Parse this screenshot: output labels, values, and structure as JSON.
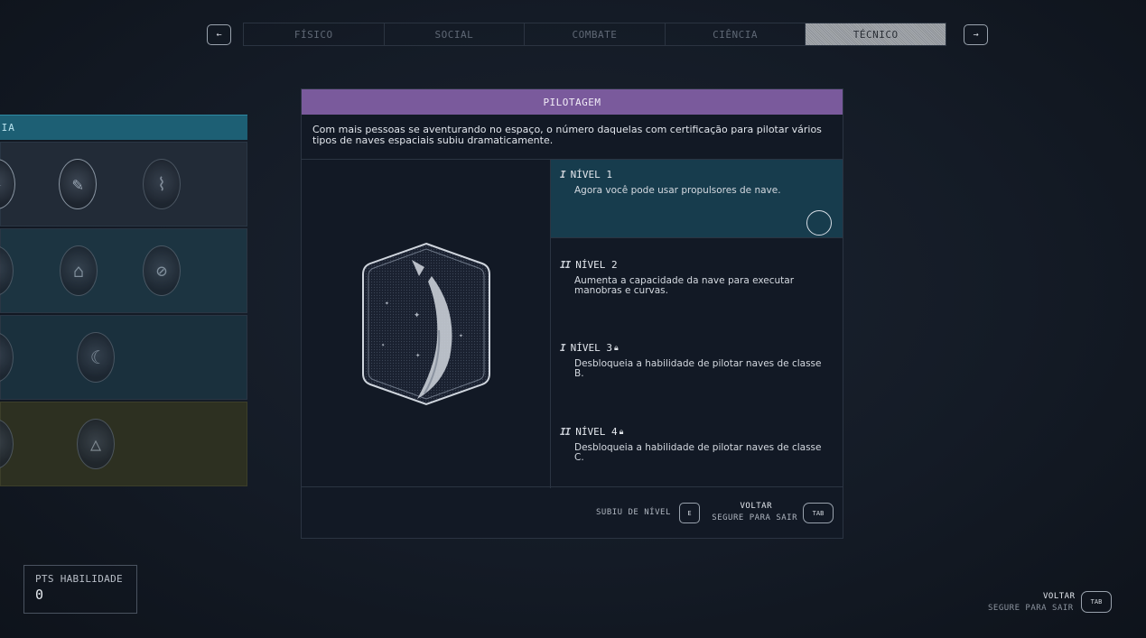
{
  "nav": {
    "prev_icon": "arrow-left-icon",
    "prev_glyph": "←",
    "next_icon": "arrow-right-icon",
    "next_glyph": "→",
    "tabs": [
      {
        "label": "FÍSICO",
        "active": false
      },
      {
        "label": "SOCIAL",
        "active": false
      },
      {
        "label": "COMBATE",
        "active": false
      },
      {
        "label": "CIÊNCIA",
        "active": false
      },
      {
        "label": "TÉCNICO",
        "active": true
      }
    ]
  },
  "skill_grid": {
    "header": "CIA"
  },
  "panel": {
    "title": "PILOTAGEM",
    "description_line1": "Com mais pessoas se aventurando no espaço, o número daquelas com certificação para pilotar vários",
    "description_line2": "tipos de naves espaciais subiu dramaticamente.",
    "ranks": [
      {
        "title": "NÍVEL 1",
        "desc": "Agora você pode usar propulsores de nave.",
        "locked": false
      },
      {
        "title": "NÍVEL 2",
        "desc_line1": "Aumenta a capacidade da nave para executar",
        "desc_line2": "manobras e curvas.",
        "locked": false
      },
      {
        "title": "NÍVEL 3",
        "desc_line1": "Desbloqueia a habilidade de pilotar naves de classe",
        "desc_line2": "B.",
        "locked": true
      },
      {
        "title": "NÍVEL 4",
        "desc_line1": "Desbloqueia a habilidade de pilotar naves de classe",
        "desc_line2": "C.",
        "locked": true
      }
    ],
    "footer": {
      "rank_up_label": "SUBIU DE NÍVEL",
      "rank_up_key": "E",
      "back_label": "VOLTAR",
      "hold_label": "SEGURE PARA SAIR",
      "back_key": "TAB"
    }
  },
  "pts": {
    "label": "PTS HABILIDADE",
    "value": "0"
  },
  "bottom_right": {
    "back_label": "VOLTAR",
    "hold_label": "SEGURE PARA SAIR",
    "key": "TAB"
  },
  "colors": {
    "title_bar": "#7a5a9c",
    "selected_rank": "#173c4d",
    "grid_header": "#1d5f74"
  }
}
